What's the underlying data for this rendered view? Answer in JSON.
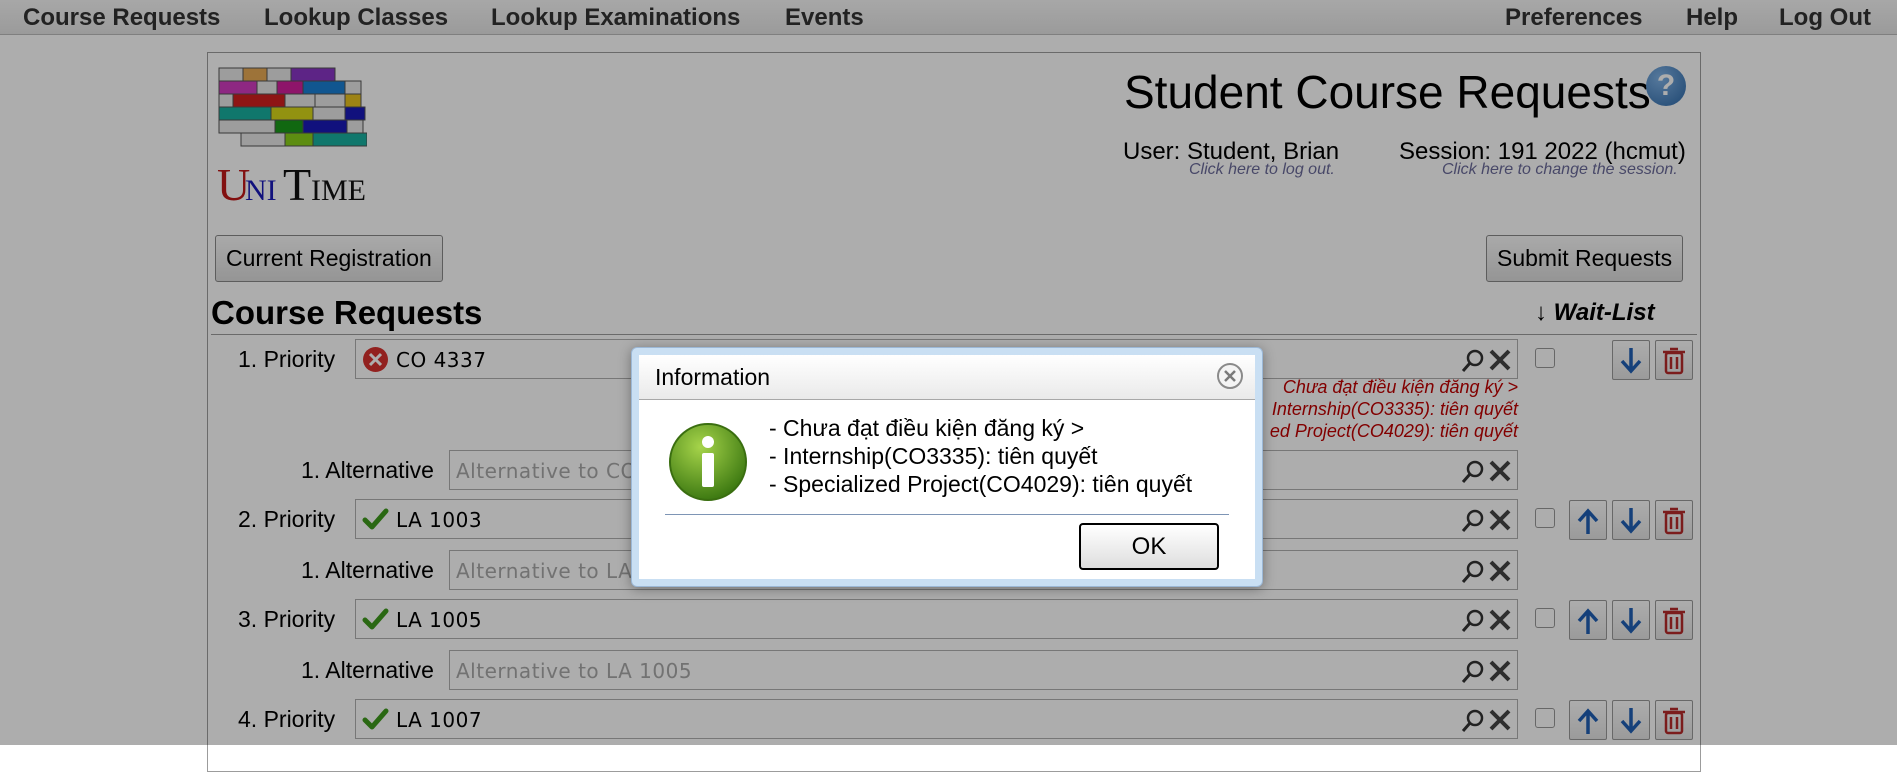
{
  "menu": {
    "left": [
      "Course Requests",
      "Lookup Classes",
      "Lookup Examinations",
      "Events"
    ],
    "right": [
      "Preferences",
      "Help",
      "Log Out"
    ]
  },
  "header": {
    "title": "Student Course Requests",
    "help_glyph": "?",
    "user_label": "User: Student, Brian",
    "user_hint": "Click here to log out.",
    "session_label": "Session: 191 2022 (hcmut)",
    "session_hint": "Click here to change the session."
  },
  "toolbar": {
    "current_registration": "Current Registration",
    "submit_requests": "Submit Requests"
  },
  "requests": {
    "section_title": "Course Requests",
    "waitlist_header": "↓ Wait-List",
    "errors": [
      "Chưa đạt điều kiện đăng ký >",
      "Internship(CO3335): tiên quyết",
      "ed Project(CO4029): tiên quyết"
    ],
    "rows": [
      {
        "label": "1. Priority",
        "value": "CO 4337",
        "status": "error"
      },
      {
        "label": "1. Alternative",
        "placeholder": "Alternative to CO 4337"
      },
      {
        "label": "2. Priority",
        "value": "LA 1003",
        "status": "ok"
      },
      {
        "label": "1. Alternative",
        "placeholder": "Alternative to LA 1003"
      },
      {
        "label": "3. Priority",
        "value": "LA 1005",
        "status": "ok"
      },
      {
        "label": "1. Alternative",
        "placeholder": "Alternative to LA 1005"
      },
      {
        "label": "4. Priority",
        "value": "LA 1007",
        "status": "ok"
      }
    ]
  },
  "dialog": {
    "title": "Information",
    "lines": [
      "- Chưa đạt điều kiện đăng ký >",
      "-  Internship(CO3335): tiên quyết",
      "-  Specialized Project(CO4029): tiên quyết"
    ],
    "ok_label": "OK"
  },
  "colors": {
    "error_text": "#c00000",
    "arrow_blue": "#1f5fb4",
    "check_green": "#3f9a1c",
    "delete_red": "#b52a2a"
  }
}
